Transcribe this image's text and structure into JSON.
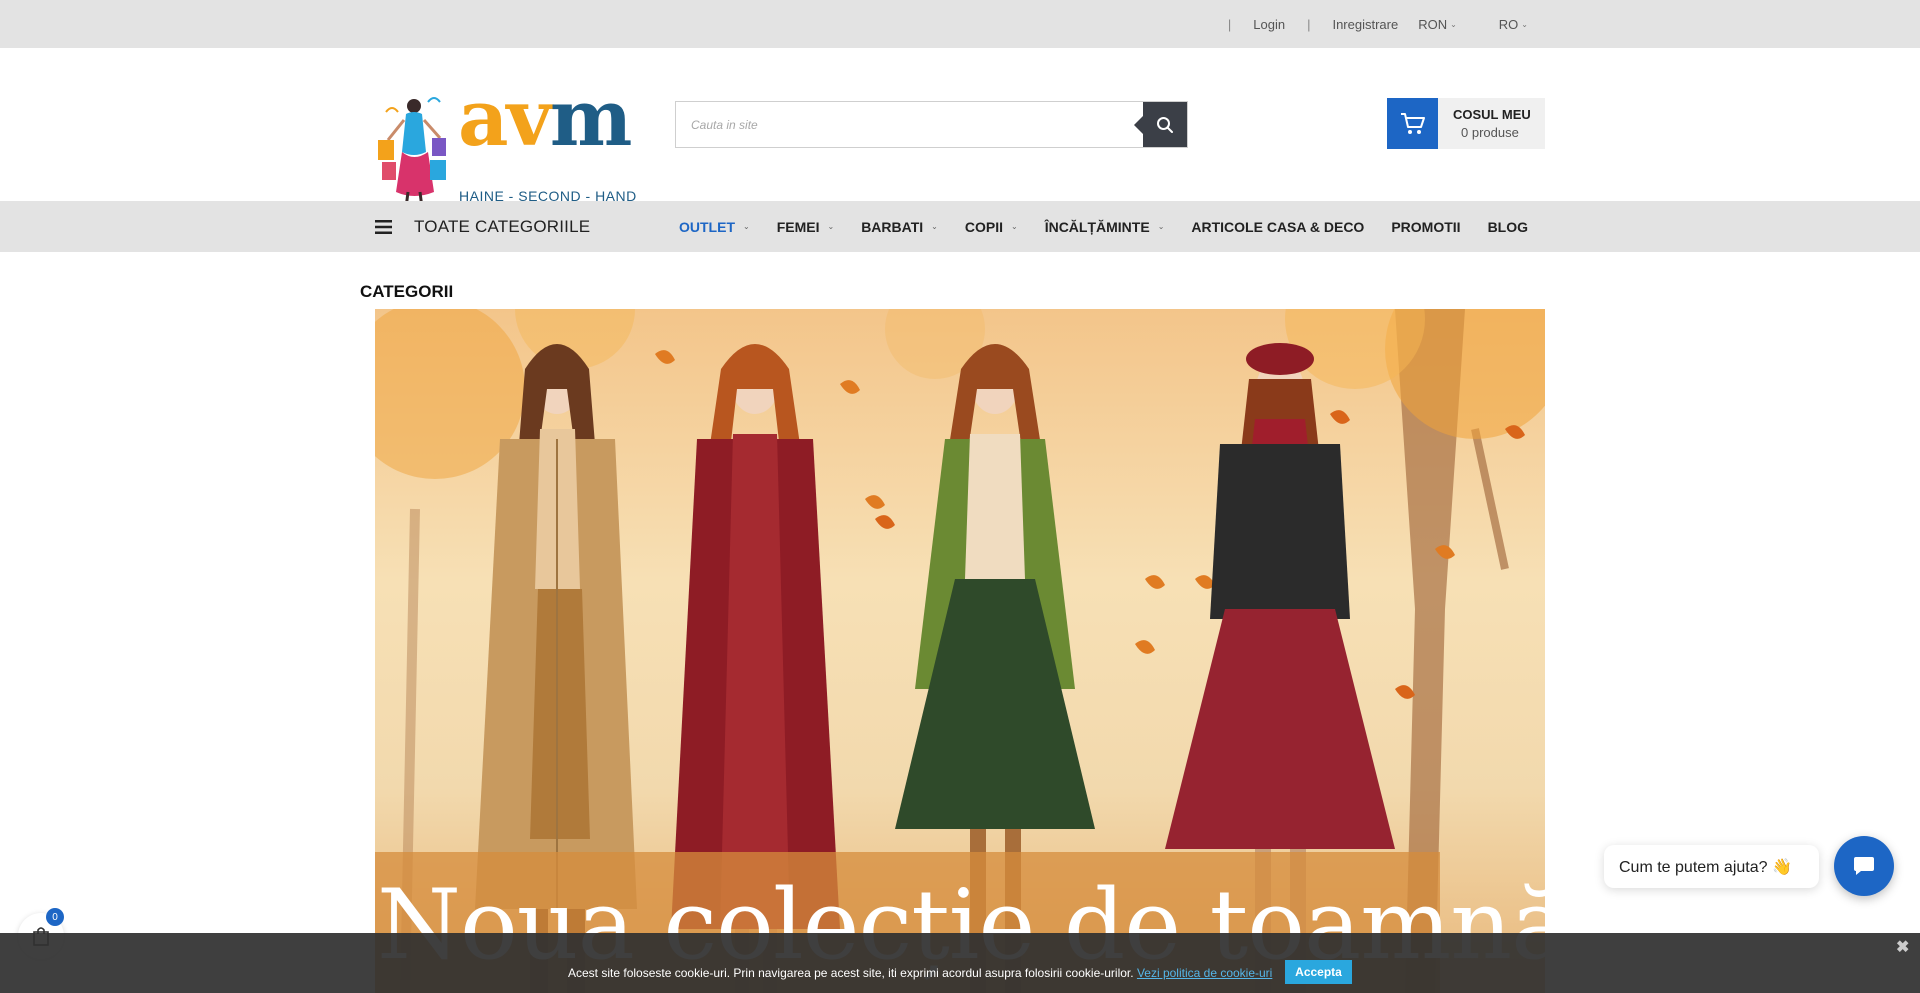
{
  "topbar": {
    "login": "Login",
    "register": "Inregistrare",
    "currency": "RON",
    "language": "RO",
    "separator": "|"
  },
  "header": {
    "logo_text_a": "a",
    "logo_text_v": "v",
    "logo_text_m": "m",
    "logo_tagline": "HAINE - SECOND - HAND",
    "search_placeholder": "Cauta in site",
    "cart_title": "COSUL MEU",
    "cart_count": "0 produse"
  },
  "nav": {
    "all_categories": "TOATE CATEGORIILE",
    "items": [
      {
        "label": "OUTLET",
        "dropdown": true,
        "active": true
      },
      {
        "label": "FEMEI",
        "dropdown": true
      },
      {
        "label": "BARBATI",
        "dropdown": true
      },
      {
        "label": "COPII",
        "dropdown": true
      },
      {
        "label": "ÎNCĂLȚĂMINTE",
        "dropdown": true
      },
      {
        "label": "ARTICOLE CASA & DECO",
        "dropdown": false
      },
      {
        "label": "PROMOTII",
        "dropdown": false
      },
      {
        "label": "BLOG",
        "dropdown": false
      }
    ]
  },
  "content": {
    "section_title": "CATEGORII",
    "banner_headline": "Noua colecție de toamnă"
  },
  "cookie": {
    "message": "Acest site foloseste cookie-uri. Prin navigarea pe acest site, iti exprimi acordul asupra folosirii cookie-urilor.",
    "policy_link": "Vezi politica de cookie-uri",
    "accept": "Accepta",
    "close": "✖"
  },
  "chat": {
    "prompt": "Cum te putem ajuta? 👋"
  },
  "mini_cart": {
    "count": "0"
  },
  "colors": {
    "accent": "#1d66c5",
    "topbar_bg": "#e3e3e3",
    "logo_orange": "#f3a21b",
    "logo_blue": "#1f5d86",
    "accept_button": "#2aa7de"
  },
  "icons": {
    "search": "search-icon",
    "cart": "cart-icon",
    "menu": "hamburger-icon",
    "chat": "chat-icon",
    "bag": "shopping-bag-icon"
  }
}
